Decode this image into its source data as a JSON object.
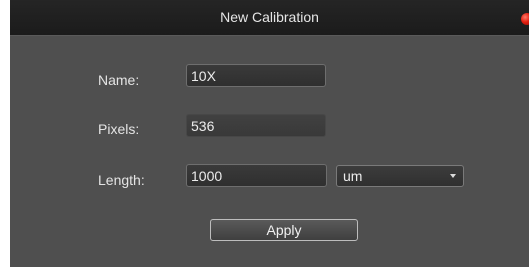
{
  "dialog": {
    "title": "New Calibration"
  },
  "form": {
    "name_label": "Name:",
    "name_value": "10X",
    "pixels_label": "Pixels:",
    "pixels_value": "536",
    "length_label": "Length:",
    "length_value": "1000",
    "unit_selected": "um",
    "apply_label": "Apply"
  },
  "colors": {
    "title_bar": "#1f1f1f",
    "panel": "#4f4f4f",
    "close_button": "#e21f10"
  },
  "icons": {
    "close": "close-icon",
    "dropdown": "chevron-down-icon"
  }
}
